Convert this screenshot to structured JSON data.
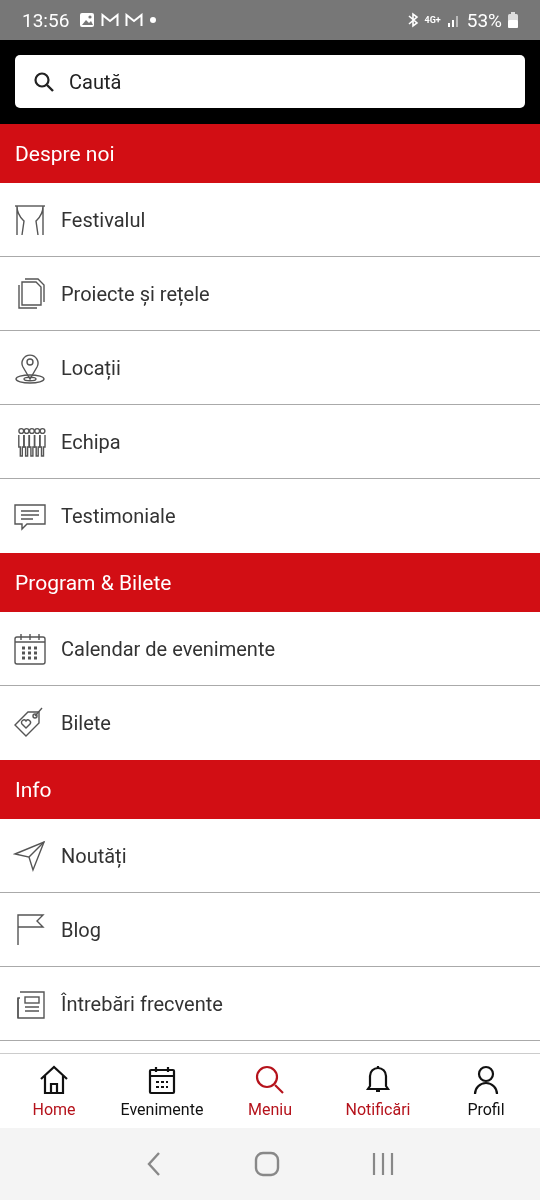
{
  "status_bar": {
    "time": "13:56",
    "network": "4G+",
    "battery": "53%"
  },
  "search": {
    "placeholder": "Caută"
  },
  "sections": [
    {
      "title": "Despre noi",
      "items": [
        {
          "label": "Festivalul"
        },
        {
          "label": "Proiecte și rețele"
        },
        {
          "label": "Locații"
        },
        {
          "label": "Echipa"
        },
        {
          "label": "Testimoniale"
        }
      ]
    },
    {
      "title": "Program & Bilete",
      "items": [
        {
          "label": "Calendar de evenimente"
        },
        {
          "label": "Bilete"
        }
      ]
    },
    {
      "title": "Info",
      "items": [
        {
          "label": "Noutăți"
        },
        {
          "label": "Blog"
        },
        {
          "label": "Întrebări frecvente"
        }
      ]
    }
  ],
  "bottom_nav": [
    {
      "label": "Home",
      "selected": false,
      "color": "#b5121b"
    },
    {
      "label": "Evenimente",
      "selected": false,
      "color": "#111111"
    },
    {
      "label": "Meniu",
      "selected": true,
      "color": "#b5121b"
    },
    {
      "label": "Notificări",
      "selected": false,
      "color": "#b5121b"
    },
    {
      "label": "Profil",
      "selected": false,
      "color": "#111111"
    }
  ]
}
